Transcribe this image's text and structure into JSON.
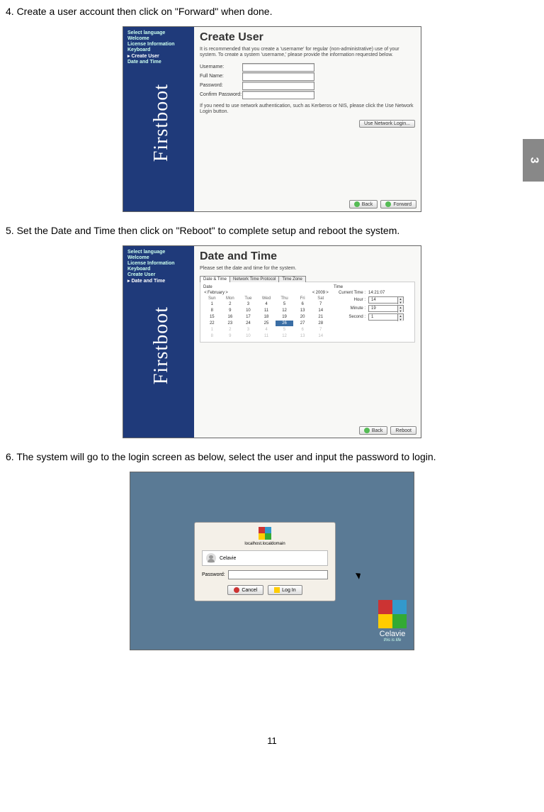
{
  "side_tab": "3",
  "step4": {
    "text": "4. Create a user account then click on \"Forward\" when done.",
    "sidebar": [
      "Select language",
      "Welcome",
      "License Information",
      "Keyboard",
      "Create User",
      "Date and Time"
    ],
    "active_index": 4,
    "firstboot": "Firstboot",
    "title": "Create User",
    "desc": "It is recommended that you create a 'username' for regular (non-administrative) use of your system. To create a system 'username,' please provide the information requested below.",
    "fields": {
      "username": "Username:",
      "fullname": "Full Name:",
      "password": "Password:",
      "confirm": "Confirm Password:"
    },
    "network_note": "If you need to use network authentication, such as Kerberos or NIS, please click the Use Network Login button.",
    "network_button": "Use Network Login...",
    "back": "Back",
    "forward": "Forward"
  },
  "step5": {
    "text": "5. Set the Date and Time then click on \"Reboot\" to complete setup and reboot the system.",
    "sidebar": [
      "Select language",
      "Welcome",
      "License Information",
      "Keyboard",
      "Create User",
      "Date and Time"
    ],
    "active_index": 5,
    "firstboot": "Firstboot",
    "title": "Date and Time",
    "desc": "Please set the date and time for the system.",
    "tabs": [
      "Date & Time",
      "Network Time Protocol",
      "Time Zone"
    ],
    "date_label": "Date",
    "month": "February",
    "year": "2009",
    "weekdays": [
      "Sun",
      "Mon",
      "Tue",
      "Wed",
      "Thu",
      "Fri",
      "Sat"
    ],
    "days": [
      {
        "n": "1"
      },
      {
        "n": "2"
      },
      {
        "n": "3"
      },
      {
        "n": "4"
      },
      {
        "n": "5"
      },
      {
        "n": "6"
      },
      {
        "n": "7"
      },
      {
        "n": "8"
      },
      {
        "n": "9"
      },
      {
        "n": "10"
      },
      {
        "n": "11"
      },
      {
        "n": "12"
      },
      {
        "n": "13"
      },
      {
        "n": "14"
      },
      {
        "n": "15"
      },
      {
        "n": "16"
      },
      {
        "n": "17"
      },
      {
        "n": "18"
      },
      {
        "n": "19"
      },
      {
        "n": "20"
      },
      {
        "n": "21"
      },
      {
        "n": "22"
      },
      {
        "n": "23"
      },
      {
        "n": "24"
      },
      {
        "n": "25"
      },
      {
        "n": "26",
        "sel": true
      },
      {
        "n": "27"
      },
      {
        "n": "28"
      },
      {
        "n": "1",
        "m": true
      },
      {
        "n": "2",
        "m": true
      },
      {
        "n": "3",
        "m": true
      },
      {
        "n": "4",
        "m": true
      },
      {
        "n": "5",
        "m": true
      },
      {
        "n": "6",
        "m": true
      },
      {
        "n": "7",
        "m": true
      },
      {
        "n": "8",
        "m": true
      },
      {
        "n": "9",
        "m": true
      },
      {
        "n": "10",
        "m": true
      },
      {
        "n": "11",
        "m": true
      },
      {
        "n": "12",
        "m": true
      },
      {
        "n": "13",
        "m": true
      },
      {
        "n": "14",
        "m": true
      }
    ],
    "time_label": "Time",
    "current_time_label": "Current Time :",
    "current_time": "14:21:07",
    "hour_label": "Hour :",
    "hour": "14",
    "minute_label": "Minute :",
    "minute": "19",
    "second_label": "Second :",
    "second": "1",
    "back": "Back",
    "reboot": "Reboot"
  },
  "step6": {
    "text": "6. The system will go to the login screen as below, select the user and input the password to login.",
    "host": "localhost.localdomain",
    "user": "Celavie",
    "password_label": "Password:",
    "cancel": "Cancel",
    "login": "Log In",
    "brand": "Celavie",
    "tagline": "this is life"
  },
  "page_number": "11"
}
